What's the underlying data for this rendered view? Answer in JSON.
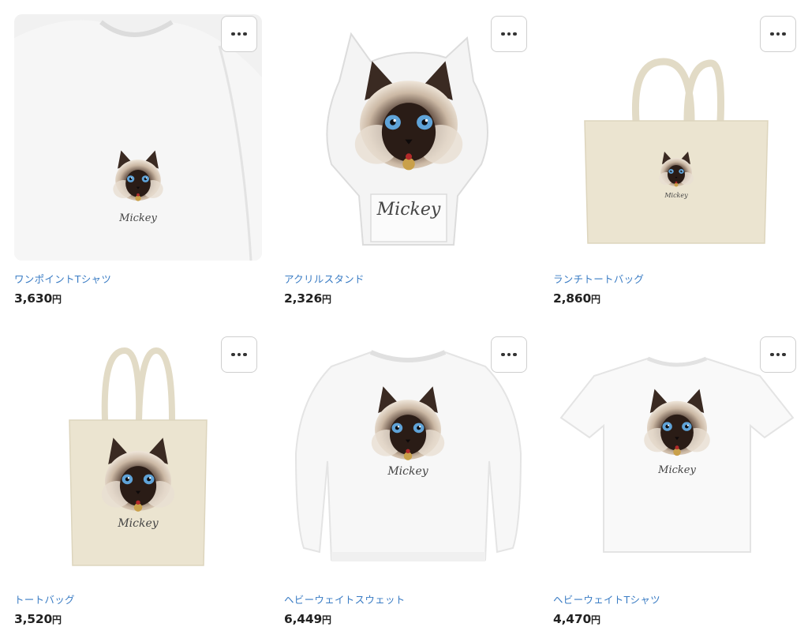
{
  "products": [
    {
      "name": "ワンポイントTシャツ",
      "price": "3,630",
      "currency": "円",
      "signature": "Mickey"
    },
    {
      "name": "アクリルスタンド",
      "price": "2,326",
      "currency": "円",
      "signature": "Mickey"
    },
    {
      "name": "ランチトートバッグ",
      "price": "2,860",
      "currency": "円",
      "signature": "Mickey"
    },
    {
      "name": "トートバッグ",
      "price": "3,520",
      "currency": "円",
      "signature": "Mickey"
    },
    {
      "name": "ヘビーウェイトスウェット",
      "price": "6,449",
      "currency": "円",
      "signature": "Mickey"
    },
    {
      "name": "ヘビーウェイトTシャツ",
      "price": "4,470",
      "currency": "円",
      "signature": "Mickey"
    }
  ],
  "icons": {
    "more": "more-dots-icon"
  },
  "colors": {
    "link": "#3a7cc4",
    "price": "#222222",
    "tee_bg": "#f1f1f1",
    "tote": "#e9e3cf",
    "acrylic_bg": "#ffffff"
  }
}
